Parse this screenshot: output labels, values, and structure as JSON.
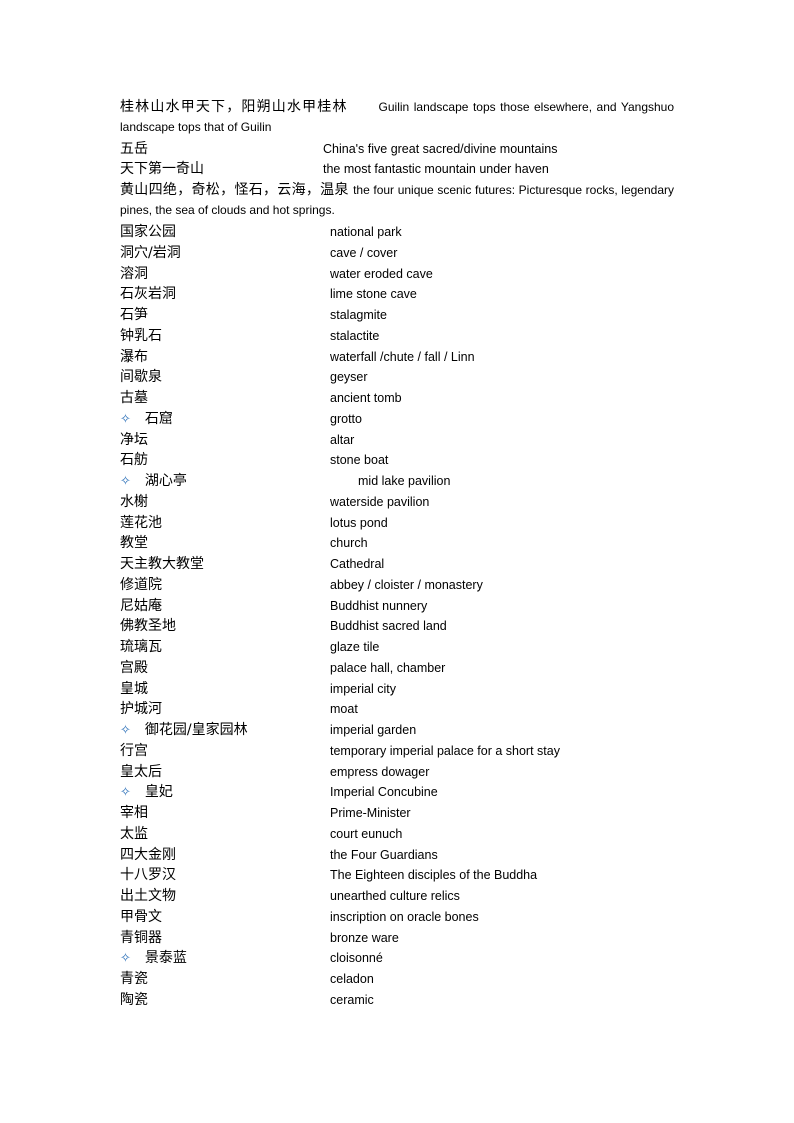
{
  "intro": [
    {
      "zh": "桂林山水甲天下，阳朔山水甲桂林",
      "en": "Guilin landscape tops those elsewhere,   and Yangshuo landscape tops that of Guilin"
    },
    {
      "zh": "黄山四绝，奇松，怪石，云海，温泉",
      "en": "the four unique scenic futures: Picturesque rocks, legendary pines,   the sea of clouds and hot springs."
    }
  ],
  "head_rows": [
    {
      "zh": "五岳",
      "en": "China's five great sacred/divine mountains"
    },
    {
      "zh": "天下第一奇山",
      "en": "the most fantastic mountain under haven"
    }
  ],
  "bullet_glyph": "✧",
  "rows": [
    {
      "zh": "国家公园",
      "en": "national park"
    },
    {
      "zh": "洞穴/岩洞",
      "en": "cave / cover"
    },
    {
      "zh": "溶洞",
      "en": "water eroded cave"
    },
    {
      "zh": "石灰岩洞",
      "en": "lime stone cave"
    },
    {
      "zh": "石笋",
      "en": "stalagmite"
    },
    {
      "zh": "钟乳石",
      "en": "stalactite"
    },
    {
      "zh": "瀑布",
      "en": "waterfall /chute / fall / Linn"
    },
    {
      "zh": "间歇泉",
      "en": "geyser"
    },
    {
      "zh": "古墓",
      "en": "ancient tomb"
    },
    {
      "zh": "石窟",
      "en": "grotto",
      "bullet": true
    },
    {
      "zh": "净坛",
      "en": "altar"
    },
    {
      "zh": "石舫",
      "en": "stone boat"
    },
    {
      "zh": "湖心亭",
      "en": "mid lake pavilion",
      "bullet": true,
      "indent": true
    },
    {
      "zh": "水榭",
      "en": "waterside pavilion"
    },
    {
      "zh": "莲花池",
      "en": "lotus pond"
    },
    {
      "zh": "教堂",
      "en": "church"
    },
    {
      "zh": "天主教大教堂",
      "en": "Cathedral"
    },
    {
      "zh": "修道院",
      "en": "abbey / cloister / monastery"
    },
    {
      "zh": "尼姑庵",
      "en": "Buddhist nunnery"
    },
    {
      "zh": "佛教圣地",
      "en": "Buddhist sacred land"
    },
    {
      "zh": "琉璃瓦",
      "en": "glaze tile"
    },
    {
      "zh": "宫殿",
      "en": "palace hall, chamber"
    },
    {
      "zh": "皇城",
      "en": "imperial city"
    },
    {
      "zh": "护城河",
      "en": "moat"
    },
    {
      "zh": "御花园/皇家园林",
      "en": "imperial garden",
      "bullet": true
    },
    {
      "zh": "行宫",
      "en": "temporary imperial palace for a short stay"
    },
    {
      "zh": "皇太后",
      "en": "empress dowager"
    },
    {
      "zh": "皇妃",
      "en": "Imperial Concubine",
      "bullet": true
    },
    {
      "zh": "宰相",
      "en": "Prime-Minister"
    },
    {
      "zh": "太监",
      "en": "court eunuch"
    },
    {
      "zh": "四大金刚",
      "en": "the Four Guardians"
    },
    {
      "zh": "十八罗汉",
      "en": "The Eighteen disciples of the Buddha"
    },
    {
      "zh": "出土文物",
      "en": "unearthed culture relics"
    },
    {
      "zh": "甲骨文",
      "en": "inscription on oracle bones"
    },
    {
      "zh": "青铜器",
      "en": "bronze ware"
    },
    {
      "zh": "景泰蓝",
      "en": "cloisonné",
      "bullet": true
    },
    {
      "zh": "青瓷",
      "en": "celadon"
    },
    {
      "zh": "陶瓷",
      "en": "ceramic"
    }
  ]
}
